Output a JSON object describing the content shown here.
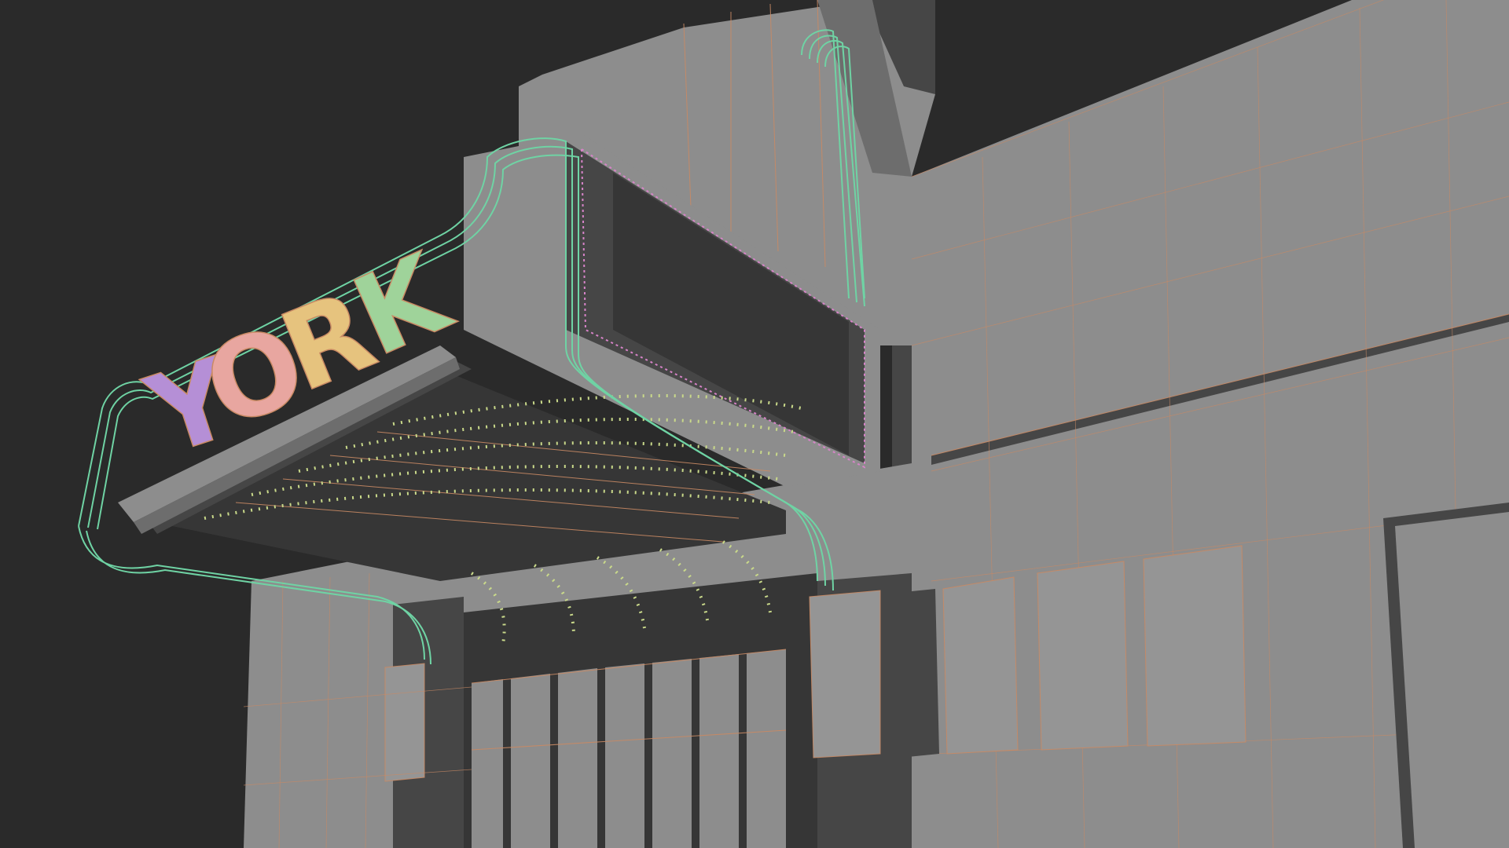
{
  "scene": {
    "marquee_sign": {
      "letters": [
        "Y",
        "O",
        "R",
        "K"
      ],
      "letter_colors": [
        "#b58fd6",
        "#e8a6a0",
        "#e6c37e",
        "#9fd39a"
      ]
    },
    "colors": {
      "background": "#2a2a2a",
      "wall_light": "#8d8d8d",
      "wall_dark": "#464646",
      "wireframe": "#c98a64",
      "neon_green": "#6fd3a4",
      "neon_pink": "#d783c8",
      "bulb_yellow": "#c9d98a"
    }
  }
}
